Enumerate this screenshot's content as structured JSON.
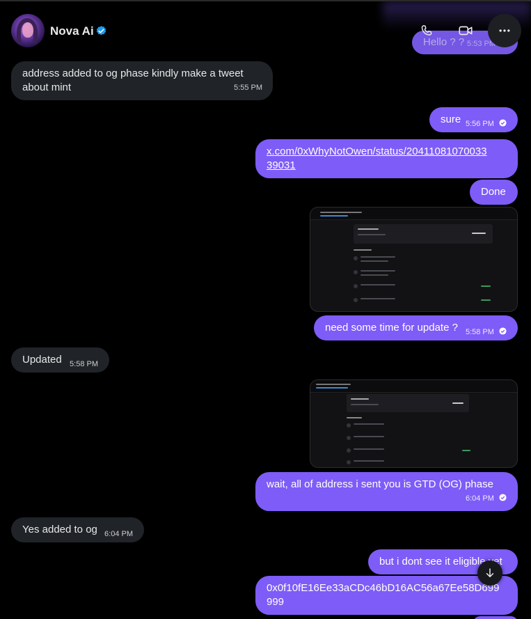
{
  "contact": {
    "name": "Nova Ai",
    "verified_icon": "verified-badge-icon",
    "avatar_icon": "avatar-photo"
  },
  "header_actions": {
    "call_icon": "phone-icon",
    "video_icon": "video-camera-icon",
    "more_icon": "more-horizontal-icon"
  },
  "ghost_message": {
    "text": "Hello ? ?",
    "time": "5:53 PM"
  },
  "messages": [
    {
      "from": "them",
      "text_line1": "address added to og phase kindly make a tweet",
      "text_line2": "about mint",
      "time": "5:55 PM"
    },
    {
      "from": "me",
      "text": "sure",
      "time": "5:56 PM"
    },
    {
      "from": "me",
      "link_line1": "x.com/0xWhyNotOwen/status/20411081070033",
      "link_line2": "39031"
    },
    {
      "from": "me",
      "text": "Done"
    },
    {
      "from": "me",
      "type": "image"
    },
    {
      "from": "me",
      "text": "need some time for update ?",
      "time": "5:58 PM"
    },
    {
      "from": "them",
      "text": "Updated",
      "time": "5:58 PM"
    },
    {
      "from": "me",
      "type": "image"
    },
    {
      "from": "me",
      "text": "wait, all of address i sent you is GTD (OG) phase",
      "time": "6:04 PM"
    },
    {
      "from": "them",
      "text": "Yes added to og",
      "time": "6:04 PM"
    },
    {
      "from": "me",
      "text": "but i dont see it eligible yet"
    },
    {
      "from": "me",
      "text_line1": "0x0f10fE16Ee33aCDc46bD16AC56a67Ee58D699",
      "text_line2": "999"
    }
  ],
  "colors": {
    "background": "#000000",
    "incoming_bubble": "#202327",
    "outgoing_bubble": "#7e5cf7",
    "verified_blue": "#1d9bf0"
  },
  "scroll_down_icon": "arrow-down-icon"
}
